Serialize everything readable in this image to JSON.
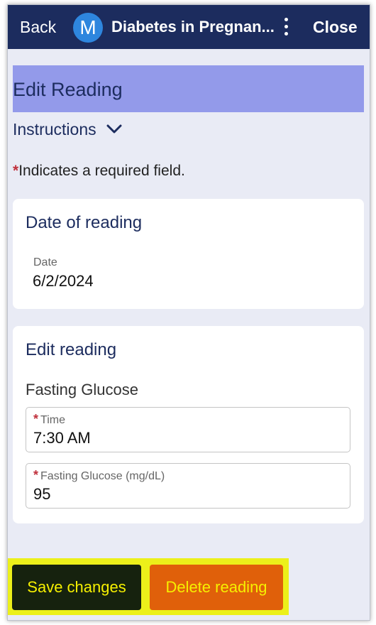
{
  "header": {
    "back_label": "Back",
    "avatar_initial": "M",
    "app_title": "Diabetes in Pregnan...",
    "close_label": "Close"
  },
  "page": {
    "title": "Edit Reading",
    "instructions_label": "Instructions",
    "required_asterisk": "*",
    "required_note": "Indicates a required field."
  },
  "date_card": {
    "title": "Date of reading",
    "date_label": "Date",
    "date_value": "6/2/2024"
  },
  "edit_card": {
    "title": "Edit reading",
    "subheading": "Fasting Glucose",
    "time_label": "Time",
    "time_value": "7:30 AM",
    "glucose_label": "Fasting Glucose (mg/dL)",
    "glucose_value": "95"
  },
  "actions": {
    "save_label": "Save changes",
    "delete_label": "Delete reading"
  },
  "colors": {
    "header_bg": "#1c2c5e",
    "title_bar_bg": "#939aea",
    "required_red": "#c0313d",
    "button_bar_bg": "#ecf01a",
    "save_bg": "#16220e",
    "delete_bg": "#e0600a"
  },
  "icons": {
    "more": "more-vertical-icon",
    "instructions": "chevron-down-icon"
  }
}
